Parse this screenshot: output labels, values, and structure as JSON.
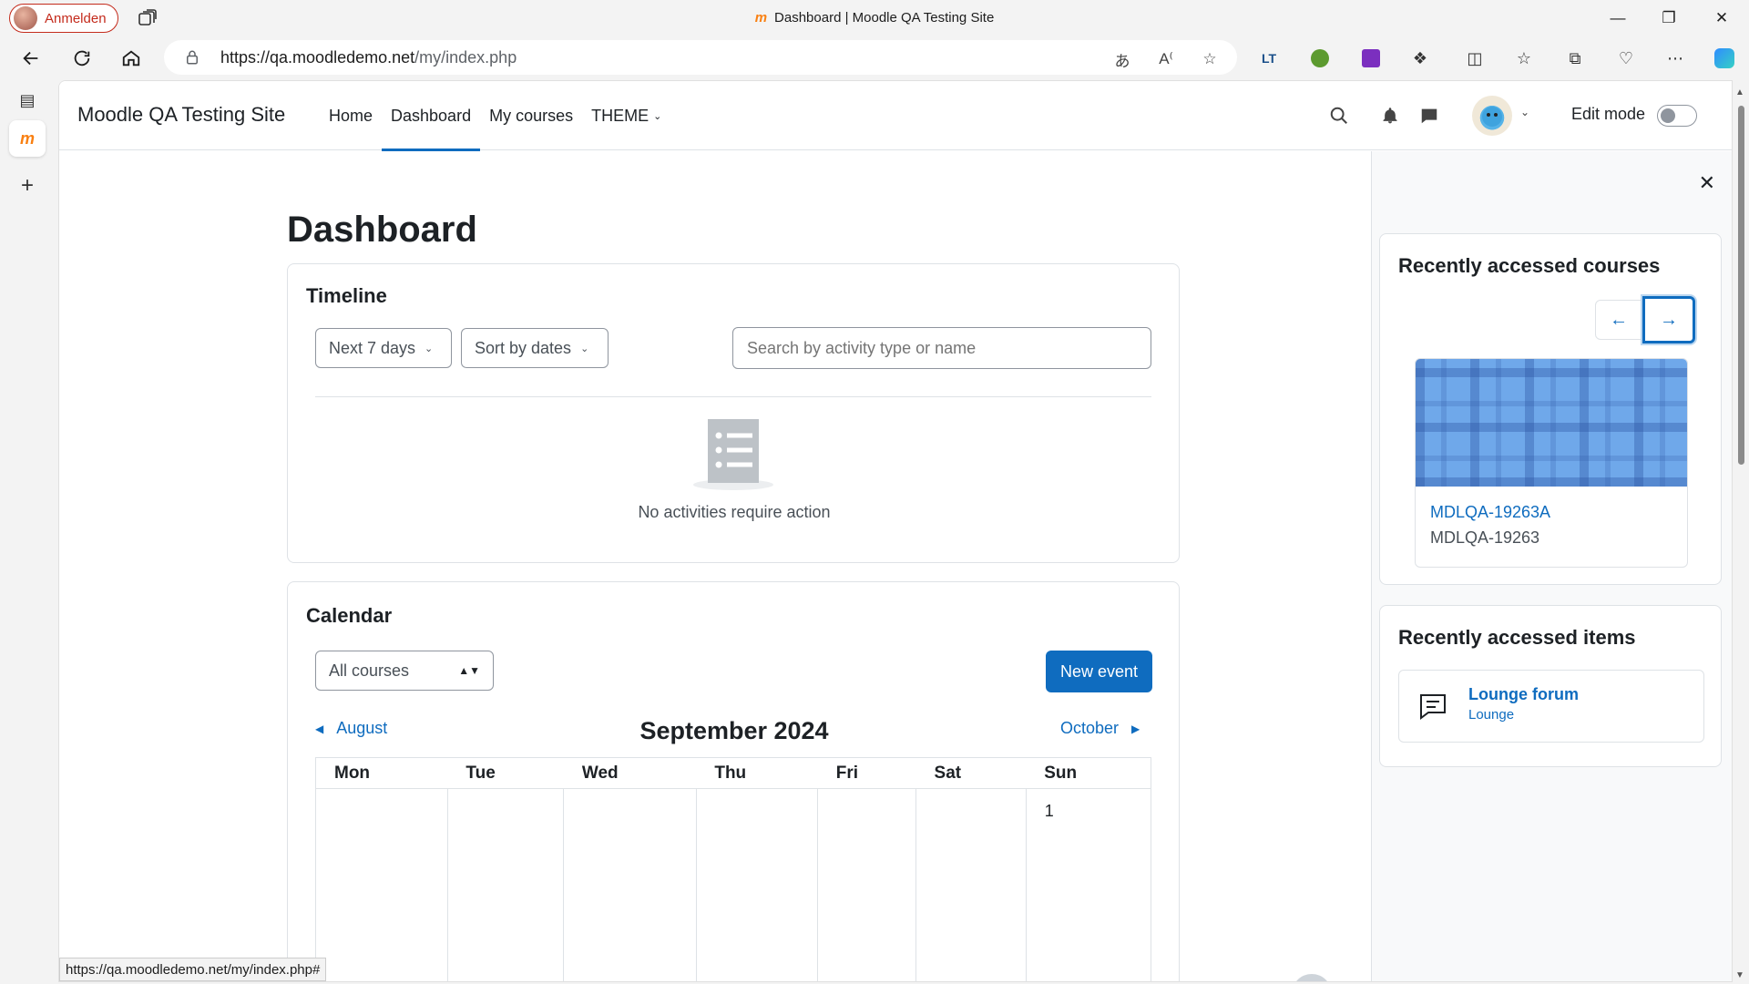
{
  "browser": {
    "profile_label": "Anmelden",
    "window_title": "Dashboard | Moodle QA Testing Site",
    "url_host": "https://qa.moodledemo.net",
    "url_path": "/my/index.php",
    "status_url": "https://qa.moodledemo.net/my/index.php#"
  },
  "site": {
    "name": "Moodle QA Testing Site",
    "nav": [
      {
        "label": "Home"
      },
      {
        "label": "Dashboard"
      },
      {
        "label": "My courses"
      },
      {
        "label": "THEME"
      }
    ],
    "edit_mode_label": "Edit mode"
  },
  "page": {
    "title": "Dashboard",
    "timeline": {
      "heading": "Timeline",
      "range_filter": "Next 7 days",
      "sort_filter": "Sort by dates",
      "search_placeholder": "Search by activity type or name",
      "empty_message": "No activities require action"
    },
    "calendar": {
      "heading": "Calendar",
      "course_filter": "All courses",
      "new_event_label": "New event",
      "prev_month": "August",
      "next_month": "October",
      "month_title": "September 2024",
      "weekdays": [
        "Mon",
        "Tue",
        "Wed",
        "Thu",
        "Fri",
        "Sat",
        "Sun"
      ],
      "first_row": [
        "",
        "",
        "",
        "",
        "",
        "",
        "1"
      ]
    },
    "help_label": "?"
  },
  "drawer": {
    "recent_courses": {
      "heading": "Recently accessed courses",
      "course_name": "MDLQA-19263A",
      "course_category": "MDLQA-19263"
    },
    "recent_items": {
      "heading": "Recently accessed items",
      "item_name": "Lounge forum",
      "item_sub": "Lounge"
    }
  },
  "colors": {
    "brand_blue": "#0f6cbf",
    "profile_red": "#c42b1c"
  }
}
